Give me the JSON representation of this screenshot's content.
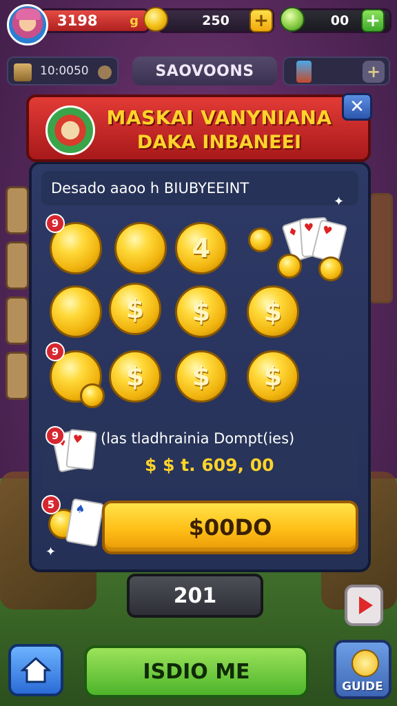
{
  "topbar": {
    "coins_value": "3198",
    "coins_suffix": "g",
    "gems_value": "250",
    "tickets_value": "00",
    "add_symbol": "+"
  },
  "subbar": {
    "left_value": "10:0050",
    "center_title": "SAOVOONS",
    "right_add": "+"
  },
  "dialog": {
    "title_line1": "MASKAI VANYNIANA",
    "title_line2": "DAKA INBANEEI",
    "close_symbol": "✕",
    "header_text": "Desado aaoo h BIUBYEEINT",
    "badges": [
      "9",
      "9",
      "9",
      "5"
    ],
    "coin_glyphs": [
      "",
      "",
      "4",
      "",
      "$",
      "$",
      "$",
      "",
      "$",
      "$",
      "$",
      "$"
    ],
    "offer_text": "(las tladhrainia Dompt(ies)",
    "offer_price": "$ $ t. 609, 00",
    "buy_label": "$00DO"
  },
  "counter_value": "201",
  "bottom": {
    "main_button_label": "ISDIO ME",
    "guide_label": "GUIDE"
  },
  "icons": [
    "avatar",
    "coin-icon",
    "gem-icon",
    "ticket-icon",
    "close-icon",
    "home-icon",
    "play-icon",
    "guide-icon"
  ]
}
